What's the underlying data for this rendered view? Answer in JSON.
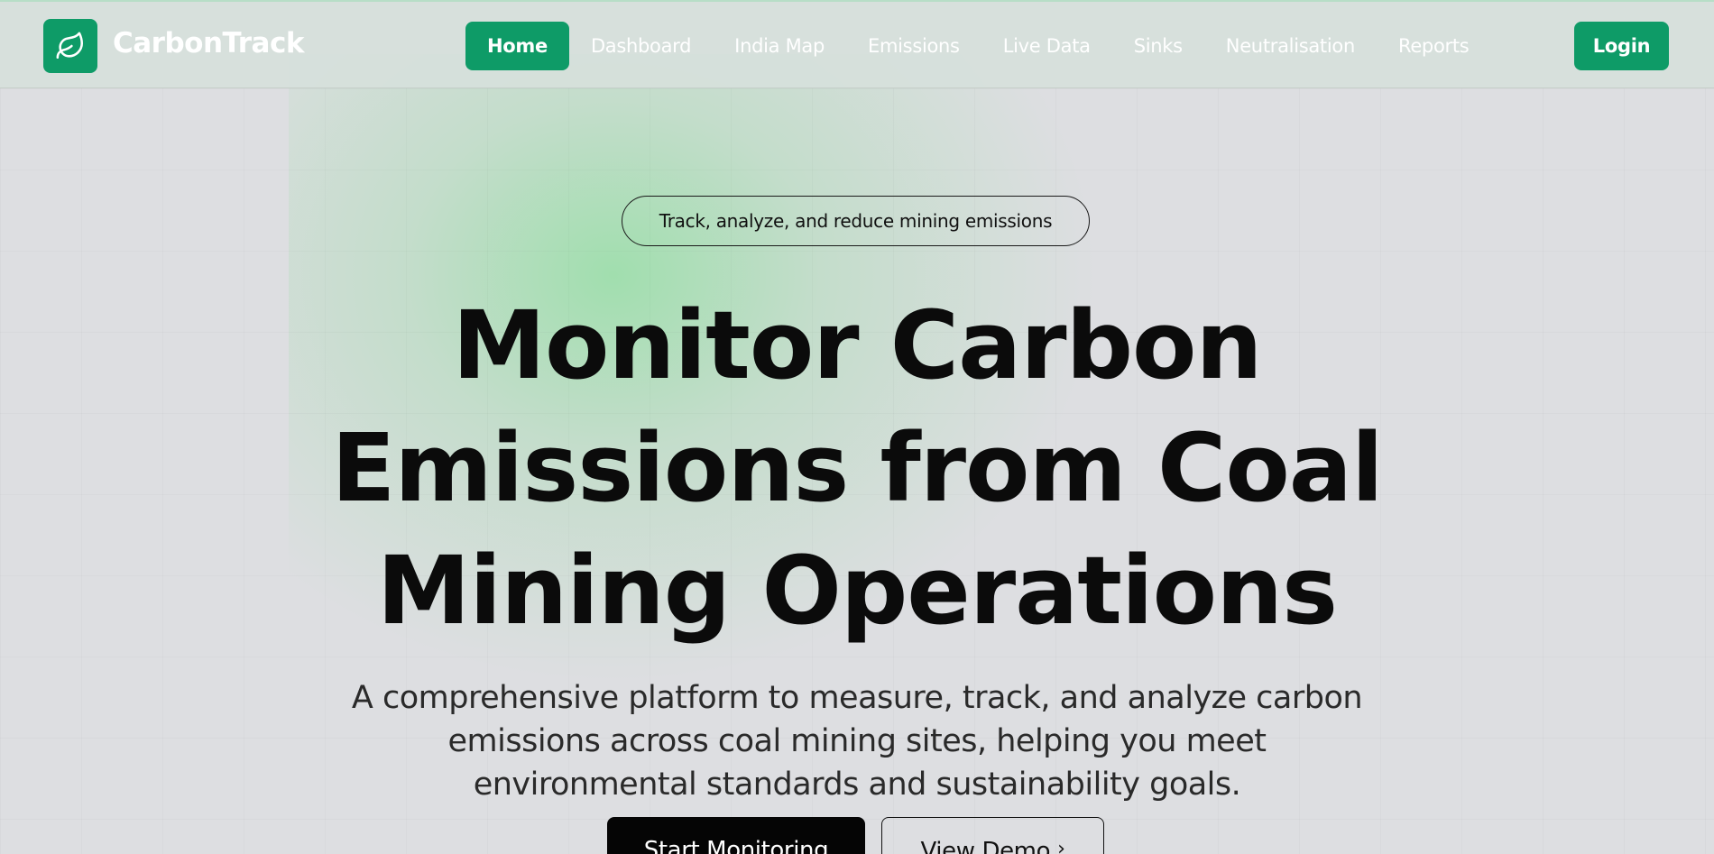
{
  "brand": {
    "name": "CarbonTrack",
    "logo_icon": "leaf-icon",
    "accent_color": "#0e9b67"
  },
  "nav": {
    "items": [
      {
        "label": "Home",
        "active": true
      },
      {
        "label": "Dashboard",
        "active": false
      },
      {
        "label": "India Map",
        "active": false
      },
      {
        "label": "Emissions",
        "active": false
      },
      {
        "label": "Live Data",
        "active": false
      },
      {
        "label": "Sinks",
        "active": false
      },
      {
        "label": "Neutralisation",
        "active": false
      },
      {
        "label": "Reports",
        "active": false
      }
    ],
    "login_label": "Login"
  },
  "hero": {
    "tagline": "Track, analyze, and reduce mining emissions",
    "headline_lines": [
      "Monitor Carbon",
      "Emissions from Coal",
      "Mining Operations"
    ],
    "description": "A comprehensive platform to measure, track, and analyze carbon emissions across coal mining sites, helping you meet environmental standards and sustainability goals.",
    "primary_button": "Start Monitoring",
    "secondary_button": "View Demo",
    "secondary_icon": "chevron-right-icon"
  }
}
